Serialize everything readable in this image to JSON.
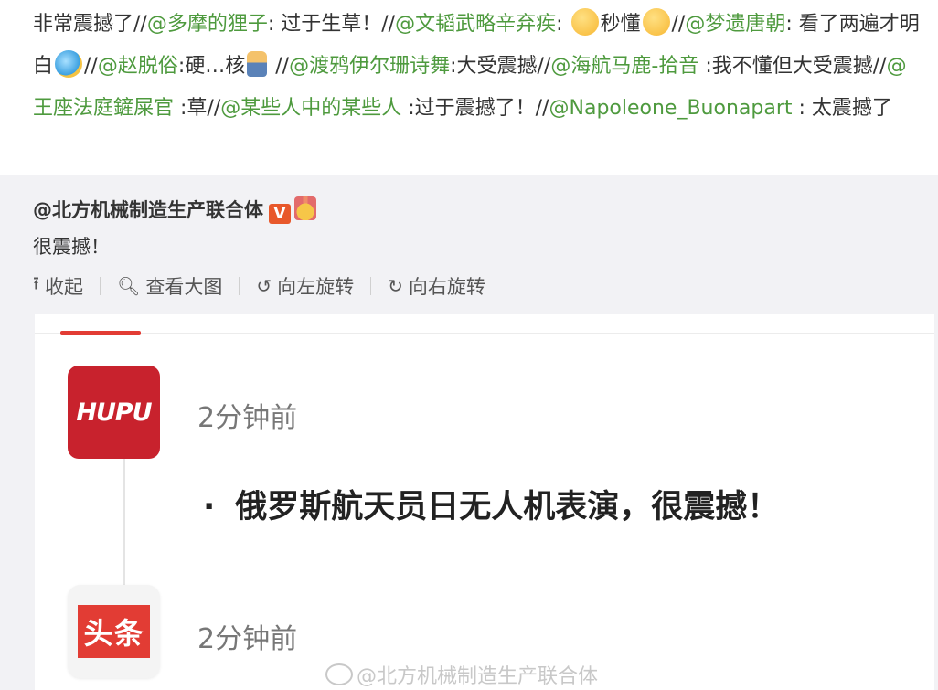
{
  "repost_chain": {
    "segments": [
      {
        "t": "text",
        "v": "非常震撼了//"
      },
      {
        "t": "mention",
        "v": "@多摩的狸子"
      },
      {
        "t": "text",
        "v": ": 过于生草！//"
      },
      {
        "t": "mention",
        "v": "@文韬武略辛弃疾"
      },
      {
        "t": "text",
        "v": ": "
      },
      {
        "t": "emoji",
        "v": "smile-emoji"
      },
      {
        "t": "text",
        "v": "秒懂"
      },
      {
        "t": "emoji",
        "v": "grin-emoji"
      },
      {
        "t": "text",
        "v": "//"
      },
      {
        "t": "mention",
        "v": "@梦遗唐朝"
      },
      {
        "t": "text",
        "v": ": 看了两遍才明白"
      },
      {
        "t": "emoji",
        "v": "crying-laughing-emoji"
      },
      {
        "t": "text",
        "v": "//"
      },
      {
        "t": "mention",
        "v": "@赵脱俗"
      },
      {
        "t": "text",
        "v": ":硬…核"
      },
      {
        "t": "emoji",
        "v": "figure-emoji"
      },
      {
        "t": "text",
        "v": " //"
      },
      {
        "t": "mention",
        "v": "@渡鸦伊尔珊诗舞"
      },
      {
        "t": "text",
        "v": ":大受震撼//"
      },
      {
        "t": "mention",
        "v": "@海航马鹿-拾音"
      },
      {
        "t": "text",
        "v": " :我不懂但大受震撼//"
      },
      {
        "t": "mention",
        "v": "@王座法庭鏟屎官"
      },
      {
        "t": "text",
        "v": " :草//"
      },
      {
        "t": "mention",
        "v": "@某些人中的某些人"
      },
      {
        "t": "text",
        "v": " :过于震撼了！//"
      },
      {
        "t": "mention",
        "v": "@Napoleone_Buonapart"
      },
      {
        "t": "text",
        "v": " : 太震撼了"
      }
    ]
  },
  "original_post": {
    "author": "@北方机械制造生产联合体",
    "verified_badge": "V",
    "text": "很震撼！",
    "actions": [
      {
        "icon": "collapse-arrow-icon",
        "glyph": "⭱",
        "label": "收起"
      },
      {
        "icon": "magnifier-icon",
        "glyph": "🔍︎",
        "label": "查看大图"
      },
      {
        "icon": "rotate-left-icon",
        "glyph": "↺",
        "label": "向左旋转"
      },
      {
        "icon": "rotate-right-icon",
        "glyph": "↻",
        "label": "向右旋转"
      }
    ]
  },
  "image": {
    "item1": {
      "logo": "HUPU",
      "time": "2分钟前",
      "headline": "俄罗斯航天员日无人机表演，很震撼！"
    },
    "item2": {
      "logo": "头条",
      "time": "2分钟前"
    },
    "watermark": "@北方机械制造生产联合体"
  },
  "colors": {
    "mention": "#4e9a3e",
    "hupu_red": "#c8222d",
    "toutiao_red": "#e23c34",
    "accent_line": "#e23c34"
  }
}
